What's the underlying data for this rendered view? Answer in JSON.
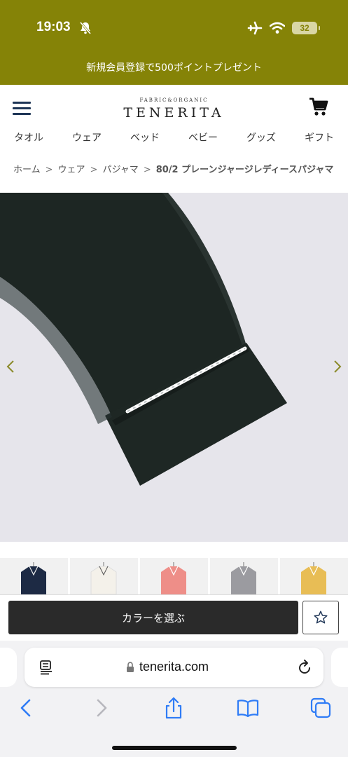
{
  "status": {
    "time": "19:03",
    "battery": "32"
  },
  "promo": {
    "text": "新規会員登録で500ポイントプレゼント"
  },
  "header": {
    "logo_small": "FABRIC&ORGANIC",
    "logo_main": "TENERITA"
  },
  "categories": [
    "タオル",
    "ウェア",
    "ベッド",
    "ベビー",
    "グッズ",
    "ギフト"
  ],
  "breadcrumb": {
    "items": [
      "ホーム",
      "ウェア",
      "パジャマ"
    ],
    "separator": ">",
    "current": "80/2 プレーンジャージレディースパジャマ"
  },
  "gallery": {
    "thumbnail_colors": [
      "#1d2a44",
      "#f4f1ea",
      "#ee8e88",
      "#9b9ba0",
      "#e8bd55"
    ]
  },
  "actions": {
    "color_button": "カラーを選ぶ"
  },
  "browser": {
    "url": "tenerita.com"
  },
  "colors": {
    "brand_olive": "#858307",
    "button_dark": "#2a2a2a",
    "safari_blue": "#2f7cf6"
  }
}
